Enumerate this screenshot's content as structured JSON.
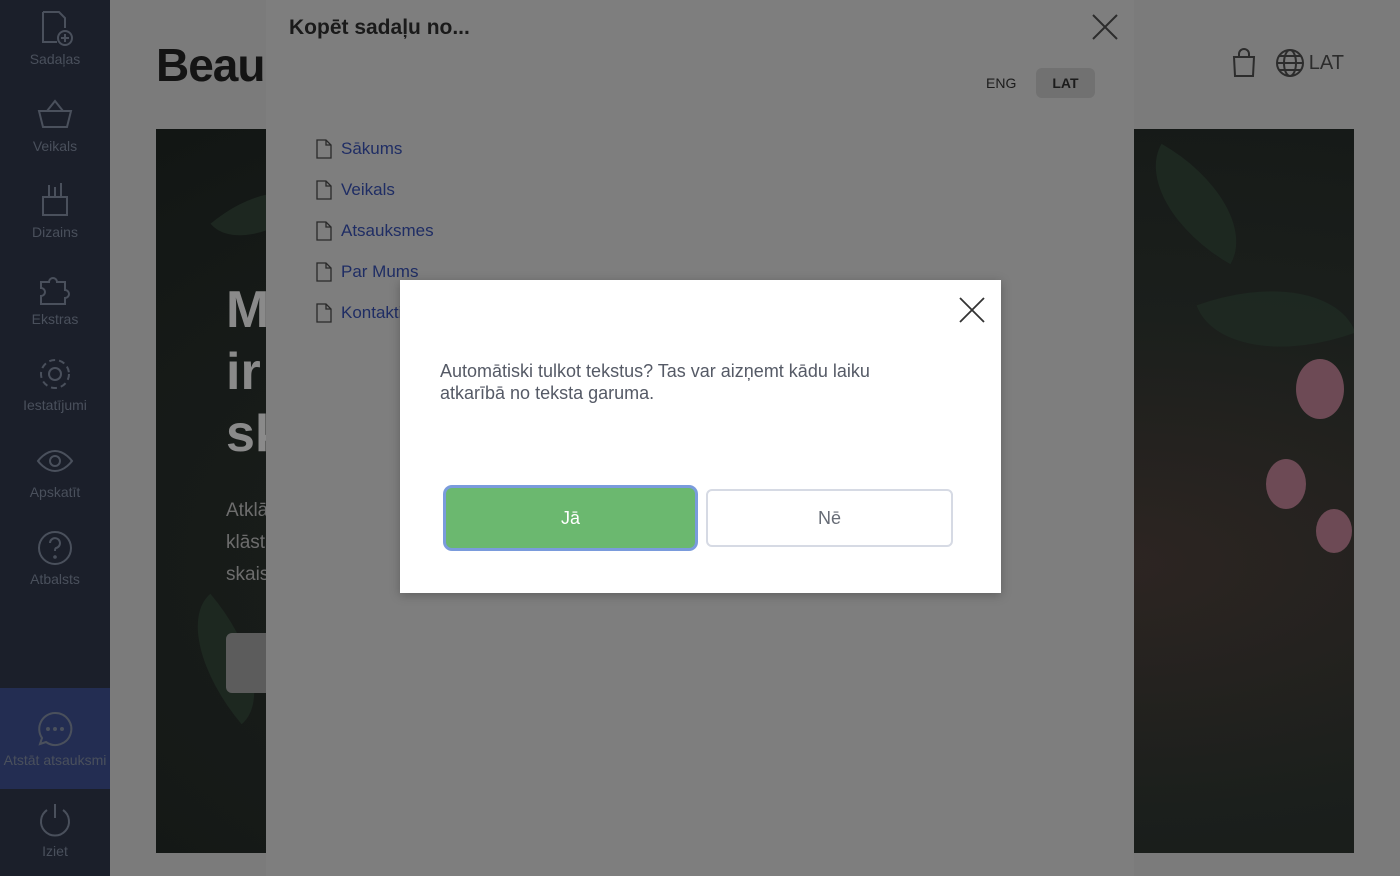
{
  "sidebar": {
    "items": [
      {
        "label": "Sadaļas",
        "icon": "add-page-icon"
      },
      {
        "label": "Veikals",
        "icon": "basket-icon"
      },
      {
        "label": "Dizains",
        "icon": "brush-icon"
      },
      {
        "label": "Ekstras",
        "icon": "puzzle-icon"
      },
      {
        "label": "Iestatījumi",
        "icon": "gear-icon"
      },
      {
        "label": "Apskatīt",
        "icon": "eye-icon"
      },
      {
        "label": "Atbalsts",
        "icon": "help-icon"
      },
      {
        "label": "Atstāt atsauksmi",
        "icon": "chat-icon"
      },
      {
        "label": "Iziet",
        "icon": "power-icon"
      }
    ]
  },
  "site": {
    "brand": "Beau",
    "language": "LAT",
    "hero_title_lines": [
      "M",
      "ir",
      "sk"
    ],
    "hero_text_lines": [
      "Atklā",
      "klāst",
      "skais"
    ]
  },
  "panel": {
    "title": "Kopēt sadaļu no...",
    "languages": [
      "ENG",
      "LAT"
    ],
    "active_language": "LAT",
    "pages": [
      "Sākums",
      "Veikals",
      "Atsauksmes",
      "Par Mums",
      "Kontakti"
    ]
  },
  "dialog": {
    "message": "Automātiski tulkot tekstus? Tas var aizņemt kādu laiku atkarībā no teksta garuma.",
    "yes_label": "Jā",
    "no_label": "Nē"
  },
  "colors": {
    "sidebar_bg": "#1b1f2a",
    "feedback_bg": "#232d52",
    "yes_button": "#6bb86f",
    "focus_ring": "#7a9bdc",
    "link": "#1f2d64"
  }
}
